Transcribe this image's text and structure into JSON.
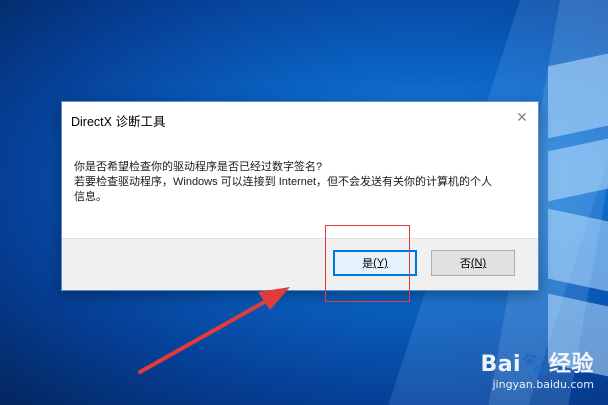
{
  "dialog": {
    "title": "DirectX 诊断工具",
    "close_glyph": "✕",
    "message_line1": "你是否希望检查你的驱动程序是否已经过数字签名?",
    "message_line2": "若要检查驱动程序，Windows 可以连接到 Internet，但不会发送有关你的计算机的个人",
    "message_line3": "信息。",
    "buttons": {
      "yes_label": "是",
      "yes_accel": "(Y)",
      "no_label": "否",
      "no_accel": "(N)"
    }
  },
  "annotation": {
    "highlight_color": "#e23b3b",
    "arrow_color": "#e23b3b"
  },
  "watermark": {
    "logo": "Bai🐾经验",
    "site": "jingyan.baidu.com"
  },
  "colors": {
    "accent": "#0078d7",
    "desktop_blue": "#0a64c4"
  }
}
